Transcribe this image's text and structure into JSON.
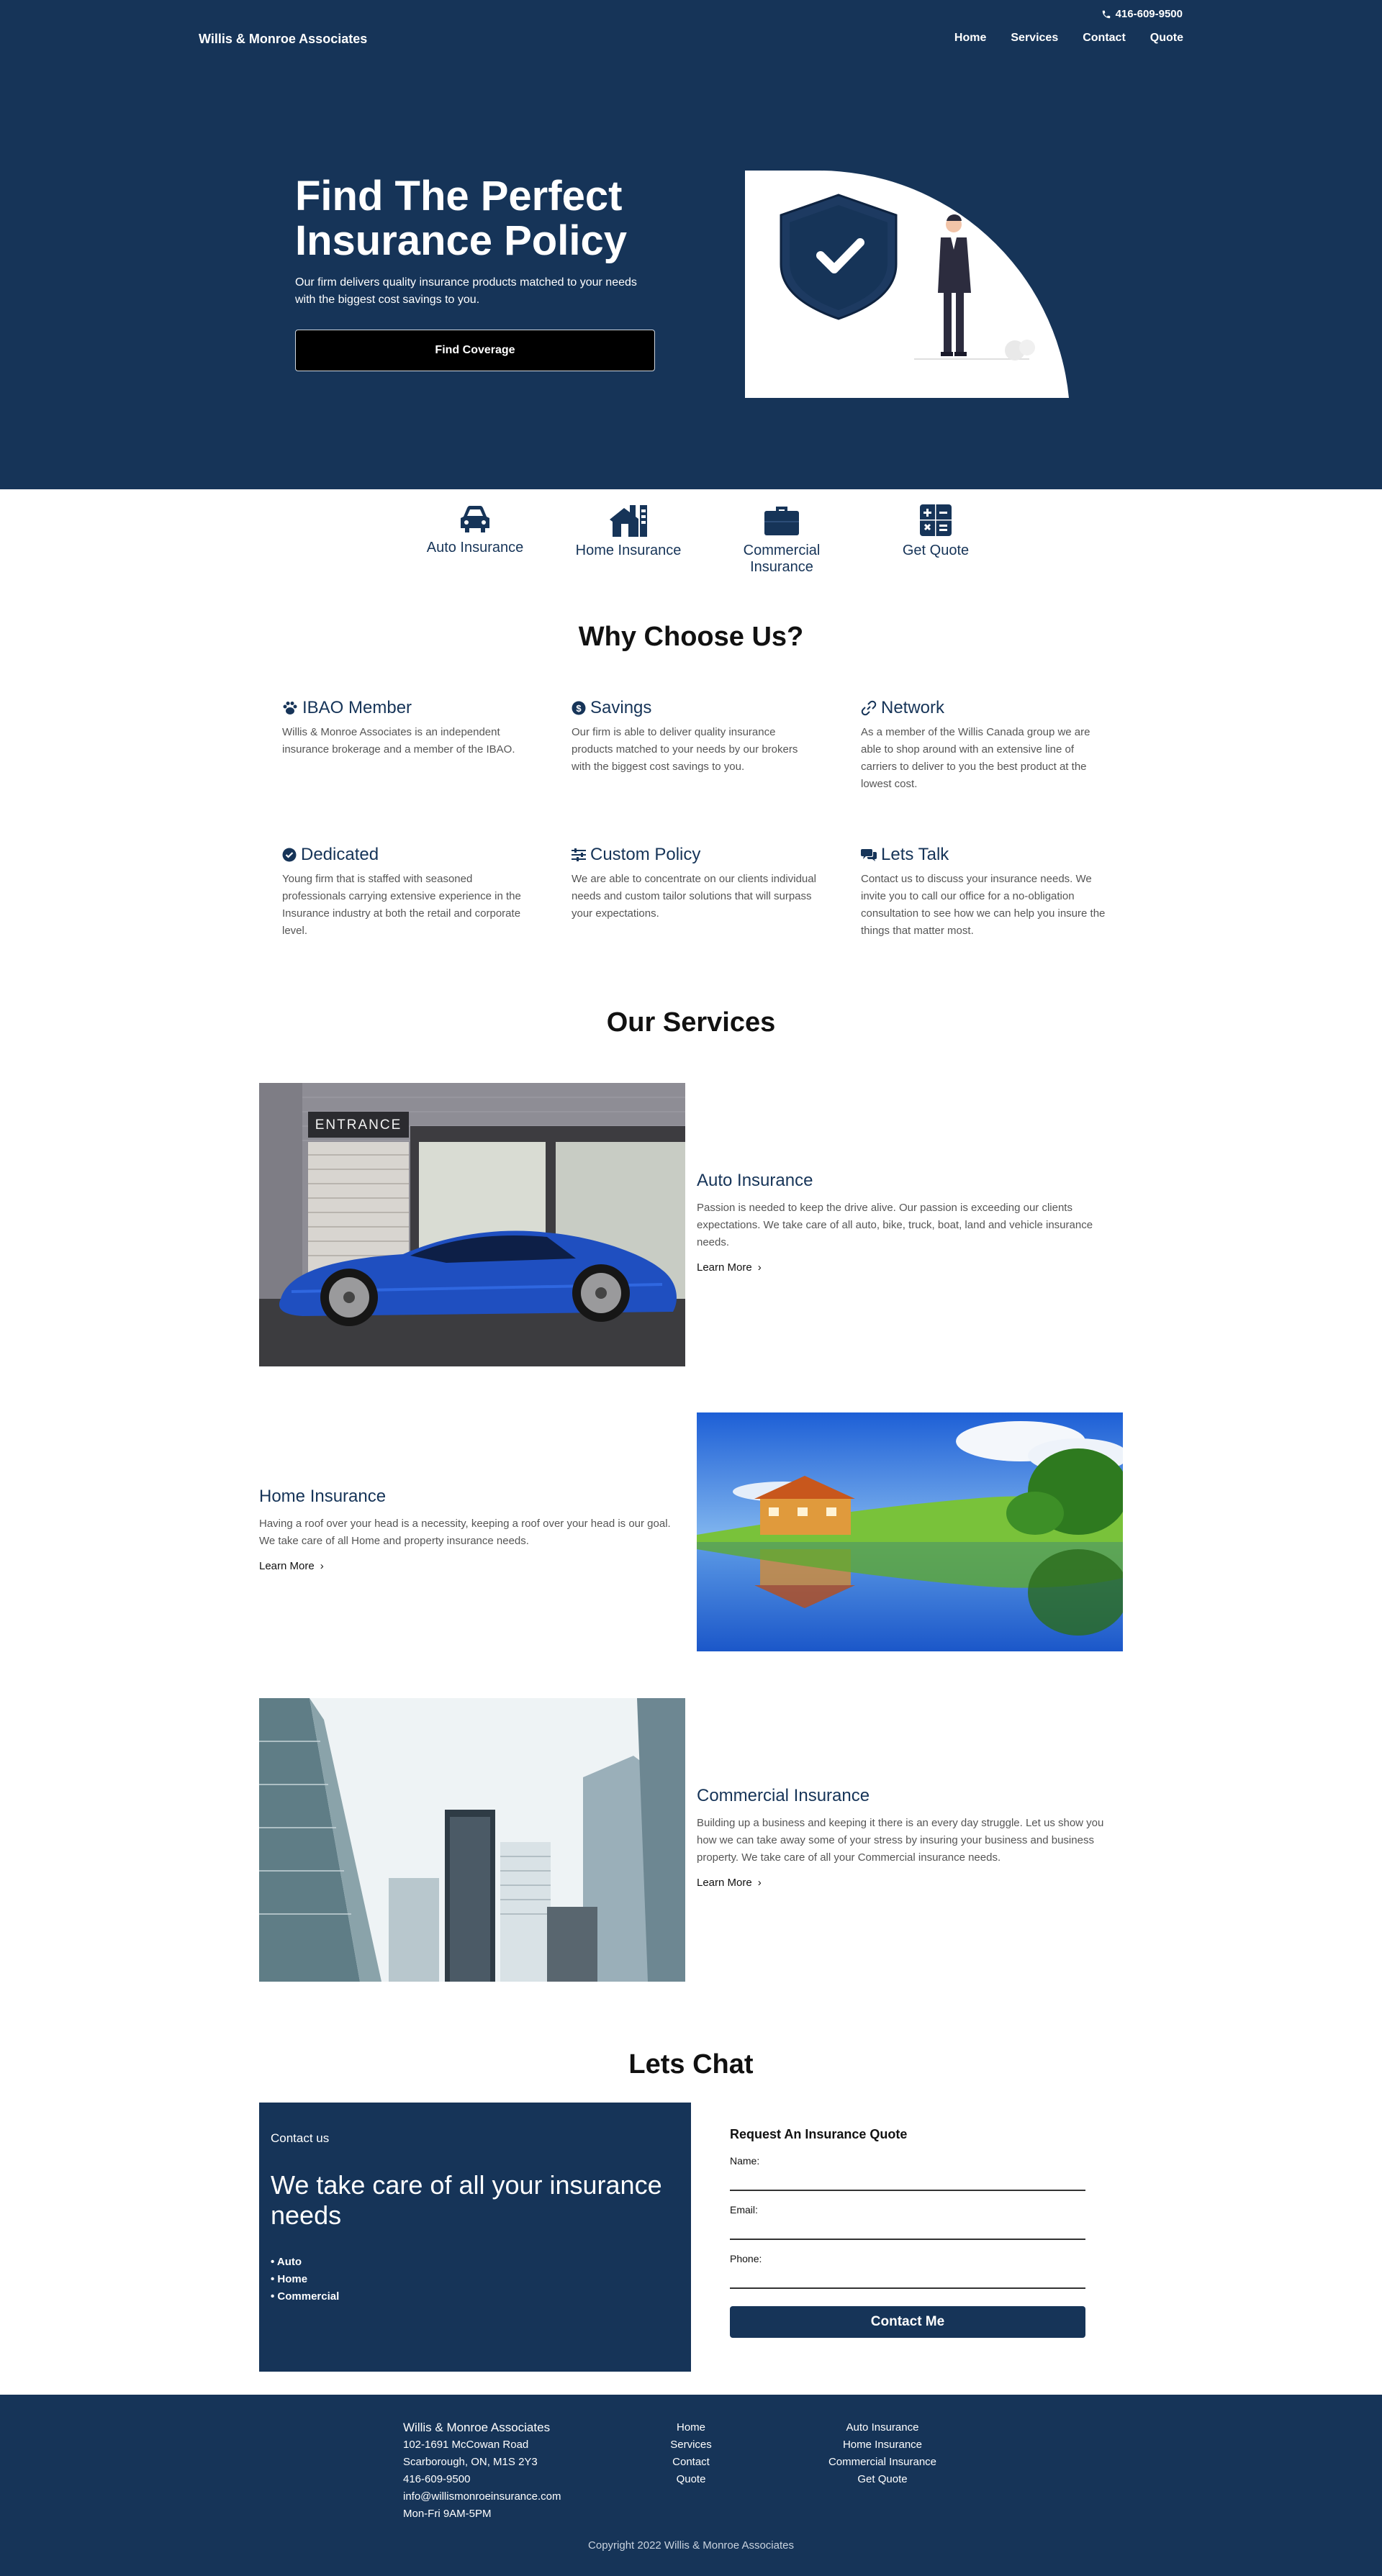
{
  "header": {
    "phone": "416-609-9500",
    "brand": "Willis & Monroe Associates",
    "nav": [
      "Home",
      "Services",
      "Contact",
      "Quote"
    ]
  },
  "hero": {
    "title": "Find The Perfect Insurance Policy",
    "subtitle": "Our firm delivers quality insurance products matched to your needs with the biggest cost savings to you.",
    "cta": "Find Coverage"
  },
  "shortcuts": [
    {
      "label": "Auto Insurance",
      "icon": "car-icon"
    },
    {
      "label": "Home Insurance",
      "icon": "house-icon"
    },
    {
      "label": "Commercial Insurance",
      "icon": "briefcase-icon"
    },
    {
      "label": "Get Quote",
      "icon": "calculator-icon"
    }
  ],
  "why": {
    "heading": "Why Choose Us?",
    "items": [
      {
        "title": "IBAO Member",
        "icon": "paw-icon",
        "text": "Willis & Monroe Associates is an independent insurance brokerage and a member of the IBAO."
      },
      {
        "title": "Savings",
        "icon": "dollar-icon",
        "text": "Our firm is able to deliver quality insurance products matched to your needs by our brokers with the biggest cost savings to you."
      },
      {
        "title": "Network",
        "icon": "link-icon",
        "text": "As a member of the Willis Canada group we are able to shop around with an extensive line of carriers to deliver to you the best product at the lowest cost."
      },
      {
        "title": "Dedicated",
        "icon": "check-badge-icon",
        "text": "Young firm that is staffed with seasoned professionals carrying extensive experience in the Insurance industry at both the retail and corporate level."
      },
      {
        "title": "Custom Policy",
        "icon": "sliders-icon",
        "text": "We are able to concentrate on our clients individual needs and custom tailor solutions that will surpass your expectations."
      },
      {
        "title": "Lets Talk",
        "icon": "chat-icon",
        "text": "Contact us to discuss your insurance needs. We invite you to call our office for a no-obligation consultation to see how we can help you insure the things that matter most."
      }
    ]
  },
  "services": {
    "heading": "Our Services",
    "items": [
      {
        "title": "Auto Insurance",
        "text": "Passion is needed to keep the drive alive. Our passion is exceeding our clients expectations. We take care of all auto, bike, truck, boat, land and vehicle insurance needs.",
        "link": "Learn More",
        "sign": "ENTRANCE"
      },
      {
        "title": "Home Insurance",
        "text": "Having a roof over your head is a necessity, keeping a roof over your head is our goal. We take care of all Home and property insurance needs.",
        "link": "Learn More"
      },
      {
        "title": "Commercial Insurance",
        "text": "Building up a business and keeping it there is an every day struggle. Let us show you how we can take away some of your stress by insuring your business and business property. We take care of all your Commercial insurance needs.",
        "link": "Learn More"
      }
    ]
  },
  "chat": {
    "heading": "Lets Chat",
    "card_label": "Contact us",
    "card_title": "We take care of all your insurance needs",
    "card_list": [
      "Auto",
      "Home",
      "Commercial"
    ],
    "form_title": "Request An Insurance Quote",
    "name_label": "Name:",
    "email_label": "Email:",
    "phone_label": "Phone:",
    "name_value": "",
    "email_value": "",
    "phone_value": "",
    "submit": "Contact Me"
  },
  "footer": {
    "company": "Willis & Monroe Associates",
    "address1": "102-1691 McCowan Road",
    "address2": "Scarborough, ON, M1S 2Y3",
    "phone": "416-609-9500",
    "email": "info@willismonroeinsurance.com",
    "hours": "Mon-Fri 9AM-5PM",
    "links1": [
      "Home",
      "Services",
      "Contact",
      "Quote"
    ],
    "links2": [
      "Auto Insurance",
      "Home Insurance",
      "Commercial Insurance",
      "Get Quote"
    ],
    "copyright": "Copyright 2022 Willis & Monroe Associates"
  },
  "colors": {
    "navy": "#163458",
    "black": "#000000",
    "white": "#ffffff"
  }
}
